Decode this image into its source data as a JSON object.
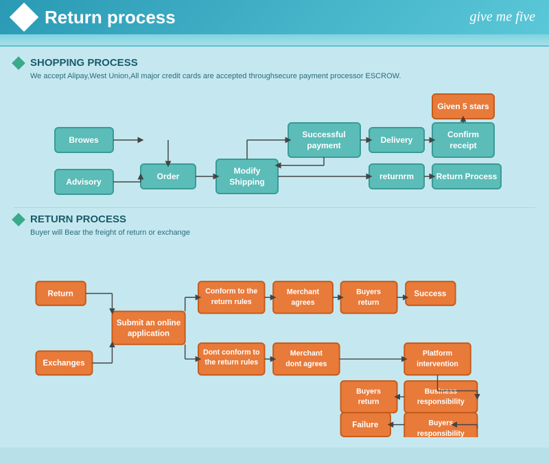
{
  "header": {
    "title": "Return process",
    "logo": "give me five"
  },
  "shopping_section": {
    "title": "SHOPPING PROCESS",
    "description": "We accept Alipay,West Union,All major credit cards are accepted throughsecure payment processor ESCROW.",
    "boxes": {
      "browes": "Browes",
      "order": "Order",
      "advisory": "Advisory",
      "modify_shipping": "Modify Shipping",
      "successful_payment": "Successful payment",
      "delivery": "Delivery",
      "confirm_receipt": "Confirm receipt",
      "given_5_stars": "Given 5 stars",
      "returnrm": "returnrm",
      "return_process": "Return Process"
    }
  },
  "return_section": {
    "title": "RETURN PROCESS",
    "description": "Buyer will Bear the freight of return or exchange",
    "boxes": {
      "return": "Return",
      "exchanges": "Exchanges",
      "submit_application": "Submit an online application",
      "conform_rules": "Conform to the return rules",
      "dont_conform_rules": "Dont conform to the return rules",
      "merchant_agrees": "Merchant agrees",
      "merchant_dont_agrees": "Merchant dont agrees",
      "buyers_return_1": "Buyers return",
      "buyers_return_2": "Buyers return",
      "success": "Success",
      "platform_intervention": "Platform intervention",
      "business_responsibility": "Business responsibility",
      "buyers_responsibility": "Buyers responsibility",
      "failure": "Failure"
    }
  }
}
